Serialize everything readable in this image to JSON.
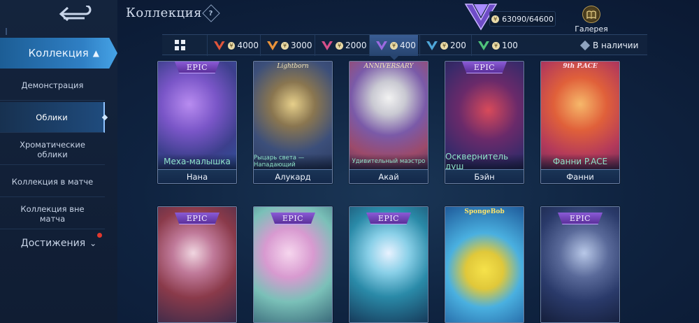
{
  "header": {
    "title": "Коллекция",
    "help_icon": "question-diamond-icon",
    "points": "63090/64600",
    "gallery_label": "Галерея"
  },
  "sidebar": {
    "back_icon": "back-arrow-icon",
    "active_section": "Коллекция",
    "items": [
      {
        "label": "Демонстрация"
      },
      {
        "label": "Облики"
      },
      {
        "label": "Хроматические облики"
      },
      {
        "label": "Коллекция в матче"
      },
      {
        "label": "Коллекция вне матча"
      }
    ],
    "achievements": "Достижения"
  },
  "filters": {
    "tiers": [
      {
        "value": "4000",
        "color": "#e0553b"
      },
      {
        "value": "3000",
        "color": "#e8923a"
      },
      {
        "value": "2000",
        "color": "#d64f8a"
      },
      {
        "value": "400",
        "color": "#9a6ae0",
        "selected": true
      },
      {
        "value": "200",
        "color": "#4fa6d8"
      },
      {
        "value": "100",
        "color": "#4fc27a"
      }
    ],
    "available_label": "В наличии"
  },
  "cards_row1": [
    {
      "badge": "EPIC",
      "skin": "Меха-малышка",
      "hero": "Нана"
    },
    {
      "badge": "",
      "logo": "Lightborn",
      "skin": "Рыцарь света — Нападающий",
      "hero": "Алукард"
    },
    {
      "badge": "",
      "logo": "ANNIVERSARY",
      "skin": "Удивительный маэстро",
      "hero": "Акай"
    },
    {
      "badge": "EPIC",
      "skin": "Осквернитель душ",
      "hero": "Бэйн"
    },
    {
      "badge": "",
      "logo": "9th P.ACE",
      "skin": "Фанни P.ACE",
      "hero": "Фанни"
    }
  ],
  "cards_row2": [
    {
      "badge": "EPIC"
    },
    {
      "badge": "EPIC"
    },
    {
      "badge": "EPIC"
    },
    {
      "badge": "",
      "logo": "SpongeBob"
    },
    {
      "badge": "EPIC"
    }
  ]
}
